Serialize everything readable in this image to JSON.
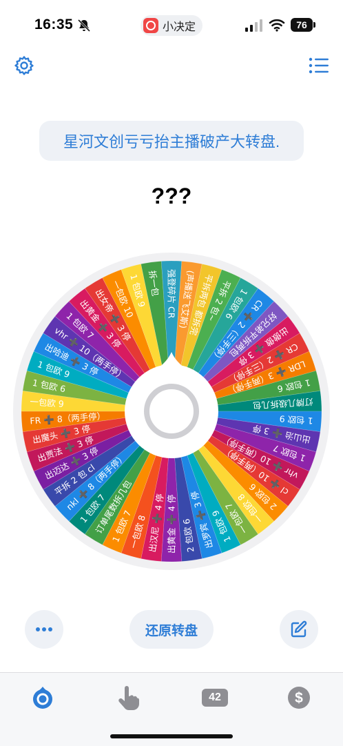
{
  "status": {
    "time": "16:35",
    "app_name": "小决定",
    "battery": "76"
  },
  "header": {
    "settings_icon": "gear-icon",
    "list_icon": "list-icon"
  },
  "wheel_title": "星河文创亏亏抬主播破产大转盘.",
  "result": "???",
  "wheel": {
    "slices": [
      {
        "label": "强登碎片 CR",
        "color": "#2a9fbf"
      },
      {
        "label": "(声播送飞艾斯)",
        "color": "#fa9a2f"
      },
      {
        "label": "平拆两包 都拆完",
        "color": "#f2c52b"
      },
      {
        "label": "平拆 2 包~",
        "color": "#4caf50"
      },
      {
        "label": "1 包欧 6",
        "color": "#26a69a"
      },
      {
        "label": "CR ➕ 2（三手停）",
        "color": "#1e88e5"
      },
      {
        "label": "好兄弟平拆两包",
        "color": "#7e57c2"
      },
      {
        "label": "出傲傲 ➕ 3 停",
        "color": "#d81b60"
      },
      {
        "label": "CR ➕ 2（三手停）",
        "color": "#e53935"
      },
      {
        "label": "LDR ➕ 3（两手停）",
        "color": "#f57c00"
      },
      {
        "label": "1 包欧 6",
        "color": "#43a047"
      },
      {
        "label": "灯牌几级拆几包",
        "color": "#00897b"
      },
      {
        "label": "1 包欧 9",
        "color": "#1e88e5"
      },
      {
        "label": "出山治 ➕ 3 停",
        "color": "#5e35b1"
      },
      {
        "label": "1 包欧 7",
        "color": "#8e24aa"
      },
      {
        "label": "vhr ➕ 10（两手停）",
        "color": "#c2185b"
      },
      {
        "label": "cl ➕ 10（两手停）",
        "color": "#e53935"
      },
      {
        "label": "2 包欧 6",
        "color": "#fb8c00"
      },
      {
        "label": "一包欧 8",
        "color": "#fdd835"
      },
      {
        "label": "一包欧 7",
        "color": "#7cb342"
      },
      {
        "label": "1 包欧 9",
        "color": "#00acc1"
      },
      {
        "label": "出罗宾 ➕ 3 停",
        "color": "#1e88e5"
      },
      {
        "label": "2 包欧 6",
        "color": "#3949ab"
      },
      {
        "label": "出黄金 ➕ 4 停",
        "color": "#8e24aa"
      },
      {
        "label": "出汉尼 ➕ 4 停",
        "color": "#d81b60"
      },
      {
        "label": "一包欧 8",
        "color": "#f4511e"
      },
      {
        "label": "1 包欧 7",
        "color": "#fb8c00"
      },
      {
        "label": "订单尾数拆几包",
        "color": "#43a047"
      },
      {
        "label": "1 包欧 7",
        "color": "#00897b"
      },
      {
        "label": "nkl ➕ 8（两手停）",
        "color": "#1e88e5"
      },
      {
        "label": "平拆 2 包 cl",
        "color": "#3949ab"
      },
      {
        "label": "出迈达 ➕ 3 停",
        "color": "#7b1fa2"
      },
      {
        "label": "出贾法 ➕ 3 停",
        "color": "#c2185b"
      },
      {
        "label": "出魔头 ➕ 3 停",
        "color": "#e53935"
      },
      {
        "label": "FR ➕ 8（两手停）",
        "color": "#f57c00"
      },
      {
        "label": "一包欧 9",
        "color": "#fdd835"
      },
      {
        "label": "1 包欧 6",
        "color": "#7cb342"
      },
      {
        "label": "1 包欧 9",
        "color": "#00acc1"
      },
      {
        "label": "出哈迪 ➕ 3 停",
        "color": "#1e88e5"
      },
      {
        "label": "vhr ➕ 10（两手停）",
        "color": "#5e35b1"
      },
      {
        "label": "1 包欧 7",
        "color": "#8e24aa"
      },
      {
        "label": "出黄金 ➕ 3 停",
        "color": "#d81b60"
      },
      {
        "label": "出女帝 ➕ 3 停",
        "color": "#e53935"
      },
      {
        "label": "一包欧 10",
        "color": "#fb8c00"
      },
      {
        "label": "1 包欧 9",
        "color": "#fdd835"
      },
      {
        "label": "拆一包",
        "color": "#43a047"
      }
    ]
  },
  "actions": {
    "more_icon": "more-icon",
    "reset_label": "还原转盘",
    "edit_icon": "edit-icon"
  },
  "tabbar": {
    "badge": "42"
  }
}
